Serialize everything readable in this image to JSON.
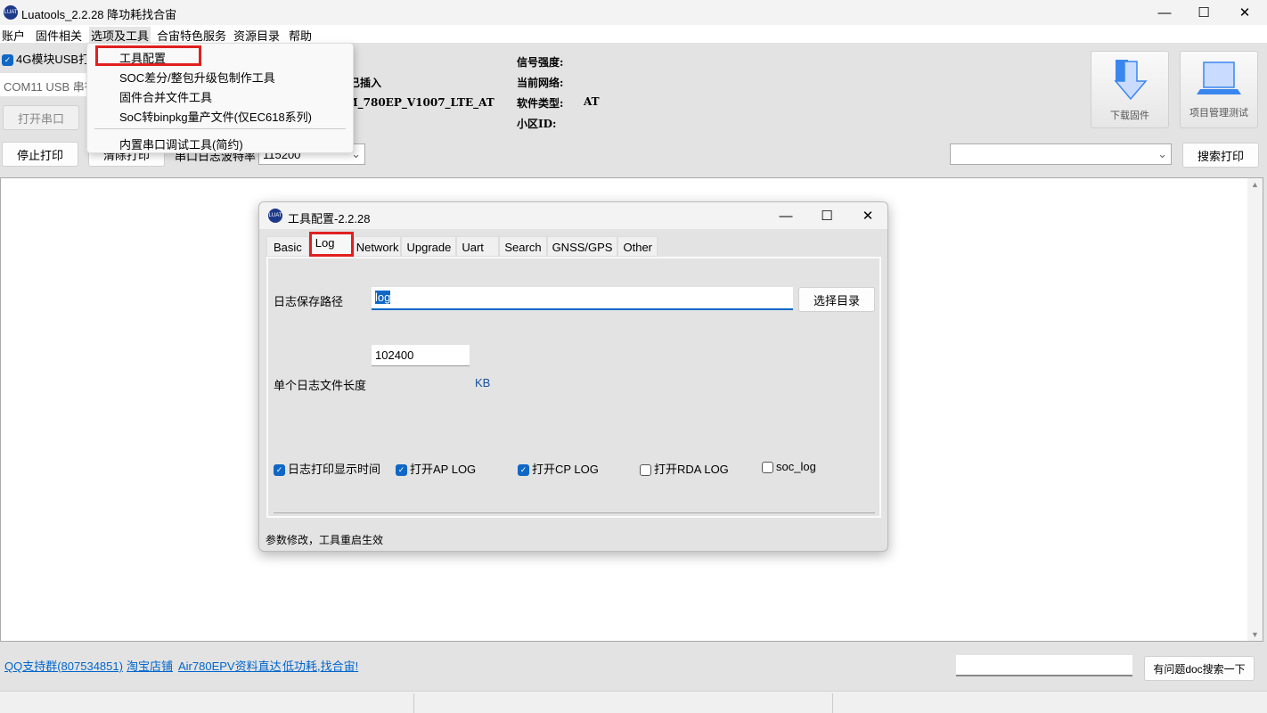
{
  "window": {
    "title": "Luatools_2.2.28 降功耗找合宙",
    "minimize": "—",
    "maximize": "☐",
    "close": "✕"
  },
  "menubar": [
    "账户",
    "固件相关",
    "选项及工具",
    "合宙特色服务",
    "资源目录",
    "帮助"
  ],
  "dropdown": {
    "items": [
      "工具配置",
      "SOC差分/整包升级包制作工具",
      "固件合并文件工具",
      "SoC转binpkg量产文件(仅EC618系列)",
      "内置串口调试工具(简约)"
    ]
  },
  "toolbar": {
    "usb_print_label": "4G模块USB打印",
    "usb_print_checked": true,
    "com_port": "COM11 USB 串行设备",
    "open_port": "打开串口",
    "stop_print": "停止打印",
    "clear_print": "清除打印",
    "baud_label": "串口日志波特率",
    "baud_value": "115200",
    "sim_status": "卡已插入",
    "firmware": "2M_780EP_V1007_LTE_AT",
    "signal_label": "信号强度:",
    "network_label": "当前网络:",
    "software_type_label": "软件类型:",
    "software_type_value": "AT",
    "cell_id_label": "小区ID:",
    "download_firmware": "下载固件",
    "project_test": "项目管理测试",
    "search_select": "",
    "search_print": "搜索打印"
  },
  "dialog": {
    "title": "工具配置-2.2.28",
    "tabs": [
      "Basic",
      "Log",
      "Network",
      "Upgrade",
      "Uart",
      "Search",
      "GNSS/GPS",
      "Other"
    ],
    "active_tab": "Log",
    "log_path_label": "日志保存路径",
    "log_path_value": "log",
    "choose_dir": "选择目录",
    "file_size_value": "102400",
    "file_size_label": "单个日志文件长度",
    "file_size_unit": "KB",
    "checkboxes": [
      {
        "label": "日志打印显示时间",
        "checked": true
      },
      {
        "label": "打开AP LOG",
        "checked": true
      },
      {
        "label": "打开CP LOG",
        "checked": true
      },
      {
        "label": "打开RDA LOG",
        "checked": false
      },
      {
        "label": "soc_log",
        "checked": false
      }
    ],
    "status": "参数修改，工具重启生效"
  },
  "footer": {
    "links": [
      "QQ支持群(807534851)",
      "淘宝店铺",
      "Air780EPV资料直达",
      "低功耗,找合宙!"
    ],
    "doc_search_input": "",
    "doc_search_button": "有问题doc搜索一下"
  },
  "colors": {
    "accent": "#0f67c6",
    "highlight_box": "#e02020",
    "link": "#0066cc"
  }
}
